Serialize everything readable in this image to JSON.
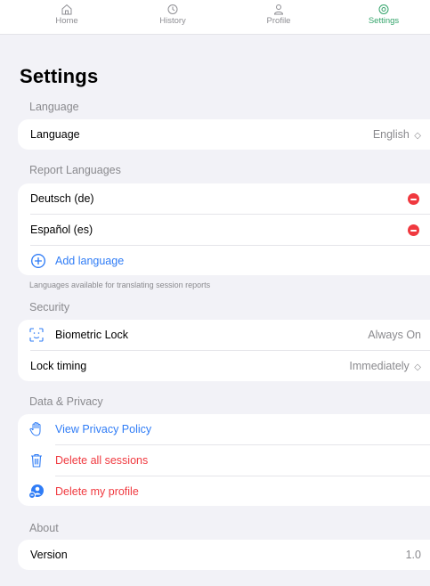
{
  "tabs": [
    {
      "label": "Home",
      "icon": "house-icon"
    },
    {
      "label": "History",
      "icon": "clock-icon"
    },
    {
      "label": "Profile",
      "icon": "person-icon"
    },
    {
      "label": "Settings",
      "icon": "gear-icon",
      "active": true
    }
  ],
  "colors": {
    "accent": "#34a46b",
    "link": "#2f7cf6",
    "destructive": "#f0393f",
    "background": "#f2f2f7"
  },
  "title": "Settings",
  "language_section": {
    "header": "Language",
    "row_label": "Language",
    "value": "English",
    "chevron": "◇"
  },
  "report_languages": {
    "header": "Report Languages",
    "items": [
      {
        "label": "Deutsch (de)"
      },
      {
        "label": "Español (es)"
      }
    ],
    "add_label": "Add language",
    "footer": "Languages available for translating session reports"
  },
  "security": {
    "header": "Security",
    "biometric_label": "Biometric Lock",
    "biometric_value": "Always On",
    "timing_label": "Lock timing",
    "timing_value": "Immediately",
    "chevron": "◇"
  },
  "privacy": {
    "header": "Data & Privacy",
    "view_policy": "View Privacy Policy",
    "delete_sessions": "Delete all sessions",
    "delete_profile": "Delete my profile"
  },
  "about": {
    "header": "About",
    "version_label": "Version",
    "version_value": "1.0"
  }
}
